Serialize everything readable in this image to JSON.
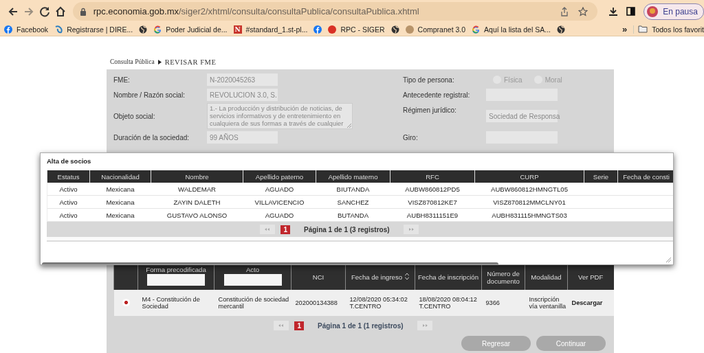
{
  "browser": {
    "nav": [
      {
        "kind": "back",
        "disabled": false
      },
      {
        "kind": "forward",
        "disabled": true
      },
      {
        "kind": "reload",
        "disabled": false
      },
      {
        "kind": "home",
        "disabled": false
      }
    ],
    "url": {
      "host": "rpc.economia.gob.mx",
      "path": "/siger2/xhtml/consulta/consultaPublica/consultaPublica.xhtml"
    },
    "profile": {
      "label": "En pausa"
    },
    "bookmarks": [
      {
        "kind": "facebook",
        "label": "Facebook"
      },
      {
        "kind": "swirl",
        "label": "Registrarse | DIRE..."
      },
      {
        "kind": "globe"
      },
      {
        "kind": "google",
        "label": "Poder Judicial de..."
      },
      {
        "kind": "letter",
        "icon_text": "N",
        "label": "#standard_1.st-pl..."
      },
      {
        "kind": "facebook"
      },
      {
        "kind": "dot",
        "color": "#d93025",
        "label": "RPC - SIGER"
      },
      {
        "kind": "globe"
      },
      {
        "kind": "dot",
        "color": "#b8946a",
        "label": "Compranet 3.0"
      },
      {
        "kind": "google",
        "label": "Aquí la lista del SA..."
      },
      {
        "kind": "globe"
      }
    ],
    "overflow": "»",
    "folder": {
      "label": "Todos los favorit"
    }
  },
  "breadcrumb": [
    "Consulta Pública",
    "REVISAR FME"
  ],
  "form": {
    "left": [
      {
        "kind": "field",
        "label": "FME:",
        "value": "N-2020045263"
      },
      {
        "kind": "field",
        "label": "Nombre / Razón social:",
        "value": "REVOLUCION 3.0, S."
      },
      {
        "kind": "textarea",
        "label": "Objeto social:",
        "value": "1.- La producción y distribución de noticias, de servicios informativos y de entretenimiento en cualquiera de sus formas a través de cualquier"
      },
      {
        "kind": "field",
        "label": "Duración de la sociedad:",
        "value": "99 AÑOS"
      }
    ],
    "right": [
      {
        "kind": "radios",
        "label": "Tipo de persona:",
        "options": [
          {
            "label": "Física",
            "selected": false
          },
          {
            "label": "Moral",
            "selected": false
          }
        ]
      },
      {
        "kind": "field",
        "label": "Antecedente registral:"
      },
      {
        "kind": "field",
        "label": "Régimen jurídico:",
        "value": "Sociedad de Responsa"
      },
      {
        "kind": "field",
        "label": "Giro:"
      }
    ]
  },
  "dialog": {
    "title": "Alta de socios",
    "columns": [
      "Estatus",
      "Nacionalidad",
      "Nombre",
      "Apellido paterno",
      "Apellido materno",
      "RFC",
      "CURP",
      "Serie",
      "Fecha de consti"
    ],
    "rows": [
      [
        "Activo",
        "Mexicana",
        "WALDEMAR",
        "AGUADO",
        "BIUTANDA",
        "AUBW860812PD5",
        "AUBW860812HMNGTL05"
      ],
      [
        "Activo",
        "Mexicana",
        "ZAYIN DALETH",
        "VILLAVICENCIO",
        "SANCHEZ",
        "VISZ870812KE7",
        "VISZ870812MMCLNY01"
      ],
      [
        "Activo",
        "Mexicana",
        "GUSTAVO ALONSO",
        "AGUADO",
        "BUTANDA",
        "AUBH8311151E9",
        "AUBH831115HMNGTS03"
      ]
    ],
    "pagination": {
      "pages": [
        {
          "label": "1",
          "selected": true
        }
      ],
      "summary": "Página 1 de 1 (3 registros)"
    }
  },
  "results": {
    "columns": [
      {
        "label": "Forma precodificada",
        "filter": true
      },
      {
        "label": "Acto",
        "filter": true
      },
      {
        "label": "NCI"
      },
      {
        "label": "Fecha de ingreso",
        "sortable": true
      },
      {
        "label": "Fecha de inscripción"
      },
      {
        "label": "Número de documento"
      },
      {
        "label": "Modalidad"
      },
      {
        "label": "Ver PDF",
        "link": true
      }
    ],
    "rows": [
      {
        "selected": true,
        "cells": [
          "M4 - Constitución de Sociedad",
          "Constitución de sociedad mercantil",
          "202000134388",
          "12/08/2020 05:34:02 T.CENTRO",
          "18/08/2020 08:04:12 T.CENTRO",
          "9366",
          "Inscripción vía ventanilla",
          "Descargar"
        ]
      }
    ],
    "pagination": {
      "pages": [
        {
          "label": "1",
          "selected": true
        }
      ],
      "summary": "Página 1 de 1 (1 registros)"
    }
  },
  "actions": [
    {
      "label": "Regresar"
    },
    {
      "label": "Continuar"
    }
  ]
}
